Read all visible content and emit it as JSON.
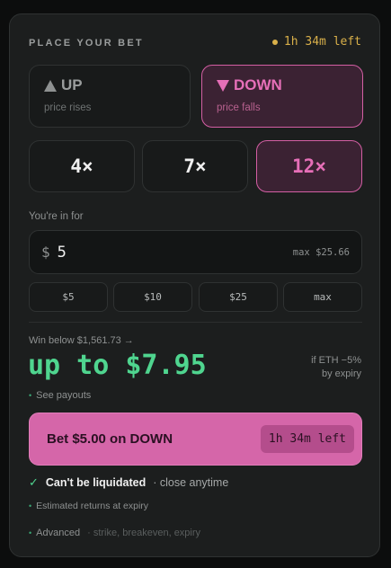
{
  "header": {
    "title": "PLACE YOUR BET",
    "timer": "1h 34m left",
    "timer_color": "#d9b04a"
  },
  "direction": {
    "up": {
      "label": "UP",
      "sub": "price rises",
      "icon": "triangle-up-icon"
    },
    "down": {
      "label": "DOWN",
      "sub": "price falls",
      "icon": "triangle-down-icon",
      "selected": true
    }
  },
  "leverage": {
    "options": [
      "4×",
      "7×",
      "12×"
    ],
    "selected": "12×"
  },
  "amount": {
    "label": "You're in for",
    "currency": "$",
    "value": "5",
    "max": "max $25.66"
  },
  "presets": [
    "$5",
    "$10",
    "$25",
    "max"
  ],
  "payout": {
    "win_below": "Win below $1,561.73 →",
    "amount": "up to $7.95",
    "condition_line1": "if ETH −5%",
    "condition_line2": "by expiry",
    "see_payouts": "See payouts",
    "color": "#4fd58f"
  },
  "cta": {
    "label": "Bet $5.00 on DOWN",
    "timer": "1h 34m left",
    "color": "#d566a9"
  },
  "liquidation": {
    "strong": "Can't be liquidated",
    "weak": "· close anytime"
  },
  "estimated": "Estimated returns at expiry",
  "advanced": {
    "label": "Advanced",
    "sub": "· strike, breakeven, expiry"
  }
}
